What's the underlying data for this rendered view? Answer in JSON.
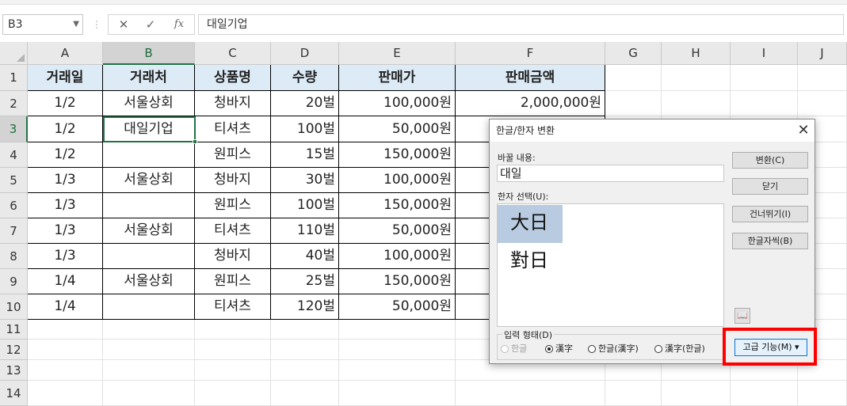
{
  "formula_bar": {
    "name_box": "B3",
    "cancel_icon": "✕",
    "enter_icon": "✓",
    "fx_label": "fx",
    "content": "대일기업"
  },
  "columns": [
    "A",
    "B",
    "C",
    "D",
    "E",
    "F",
    "G",
    "H",
    "I",
    "J"
  ],
  "rows": [
    "1",
    "2",
    "3",
    "4",
    "5",
    "6",
    "7",
    "8",
    "9",
    "10",
    "11",
    "12",
    "13",
    "14"
  ],
  "table": {
    "headers": [
      "거래일",
      "거래처",
      "상품명",
      "수량",
      "판매가",
      "판매금액"
    ],
    "rows": [
      [
        "1/2",
        "서울상회",
        "청바지",
        "20벌",
        "100,000원",
        "2,000,000원"
      ],
      [
        "1/2",
        "대일기업",
        "티셔츠",
        "100벌",
        "50,000원",
        ""
      ],
      [
        "1/2",
        "",
        "원피스",
        "15벌",
        "150,000원",
        ""
      ],
      [
        "1/3",
        "서울상회",
        "청바지",
        "30벌",
        "100,000원",
        ""
      ],
      [
        "1/3",
        "",
        "원피스",
        "100벌",
        "150,000원",
        ""
      ],
      [
        "1/3",
        "서울상회",
        "티셔츠",
        "110벌",
        "50,000원",
        ""
      ],
      [
        "1/3",
        "",
        "청바지",
        "40벌",
        "100,000원",
        ""
      ],
      [
        "1/4",
        "서울상회",
        "원피스",
        "25벌",
        "150,000원",
        ""
      ],
      [
        "1/4",
        "",
        "티셔츠",
        "120벌",
        "50,000원",
        ""
      ]
    ]
  },
  "dialog": {
    "title": "한글/한자 변환",
    "word_label": "바꿀 내용:",
    "word_value": "대일",
    "hanja_label": "한자 선택(U):",
    "hanja_options": [
      "大日",
      "對日"
    ],
    "buttons": {
      "convert": "변환(C)",
      "close": "닫기",
      "skip": "건너뛰기(I)",
      "hangul_char": "한글자씩(B)",
      "advanced": "고급 기능(M) ▾"
    },
    "dict_icon": "📖",
    "input_form_label": "입력 형태(D)",
    "input_forms": [
      "한글",
      "漢字",
      "한글(漢字)",
      "漢字(한글)"
    ],
    "selected_form": "漢字"
  }
}
